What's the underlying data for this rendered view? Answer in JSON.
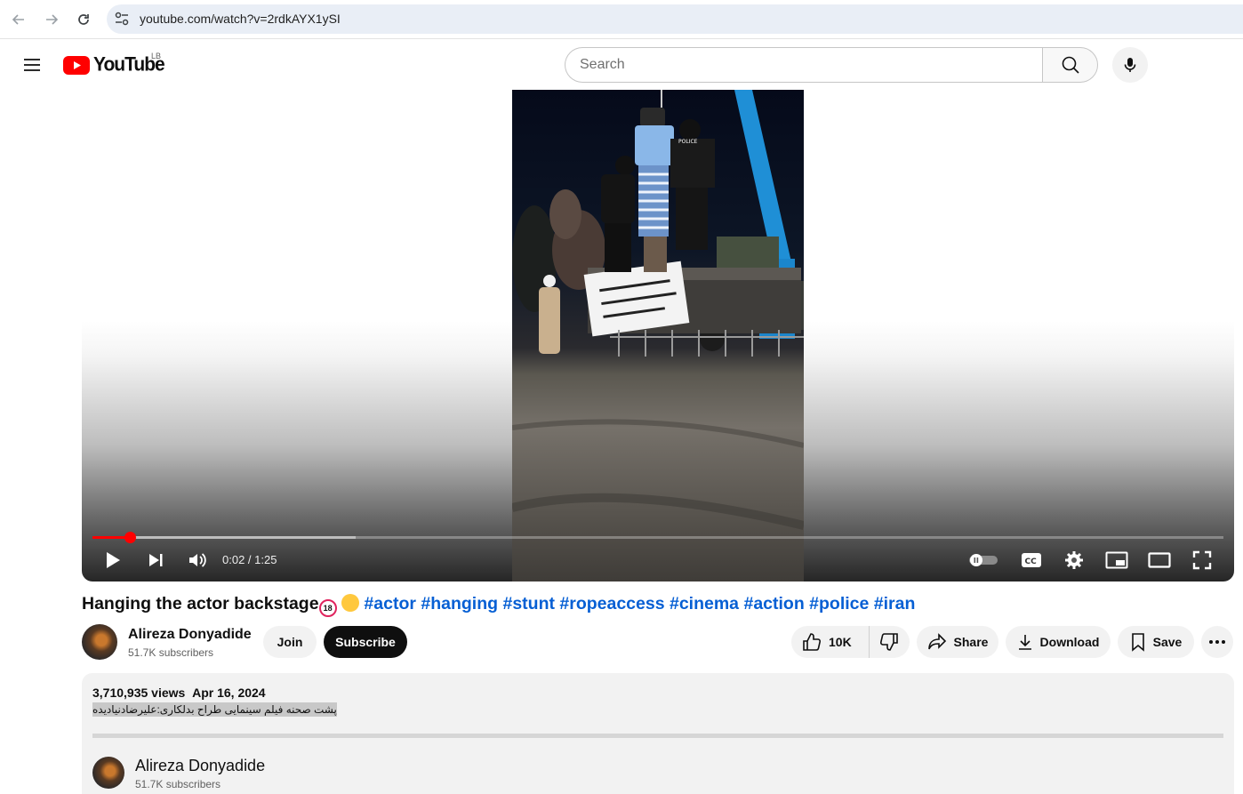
{
  "browser": {
    "url": "youtube.com/watch?v=2rdkAYX1ySI"
  },
  "header": {
    "logo_text": "YouTube",
    "country_code": "LB",
    "search_placeholder": "Search"
  },
  "player": {
    "time_current": "0:02",
    "time_total": "1:25",
    "time_display": "0:02 / 1:25",
    "progress_fraction": 0.033,
    "buffer_fraction": 0.233
  },
  "video": {
    "title_text": "Hanging the actor backstage",
    "emoji_18_text": "18",
    "hashtags": [
      "#actor",
      "#hanging",
      "#stunt",
      "#ropeaccess",
      "#cinema",
      "#action",
      "#police",
      "#iran"
    ]
  },
  "owner": {
    "channel_name": "Alireza Donyadide",
    "subscribers": "51.7K subscribers",
    "join_label": "Join",
    "subscribe_label": "Subscribe"
  },
  "actions": {
    "like_count": "10K",
    "share_label": "Share",
    "download_label": "Download",
    "save_label": "Save"
  },
  "description": {
    "views": "3,710,935 views",
    "date": "Apr 16, 2024",
    "text": "پشت صحنه فیلم سینمایی طراح بدلکاری:علیرضادنیادیده",
    "channel_name": "Alireza Donyadide",
    "subscribers": "51.7K subscribers"
  },
  "colors": {
    "youtube_red": "#ff0000",
    "link_blue": "#065fd4",
    "subscribe_bg": "#0f0f0f",
    "pill_bg": "#f2f2f2"
  }
}
